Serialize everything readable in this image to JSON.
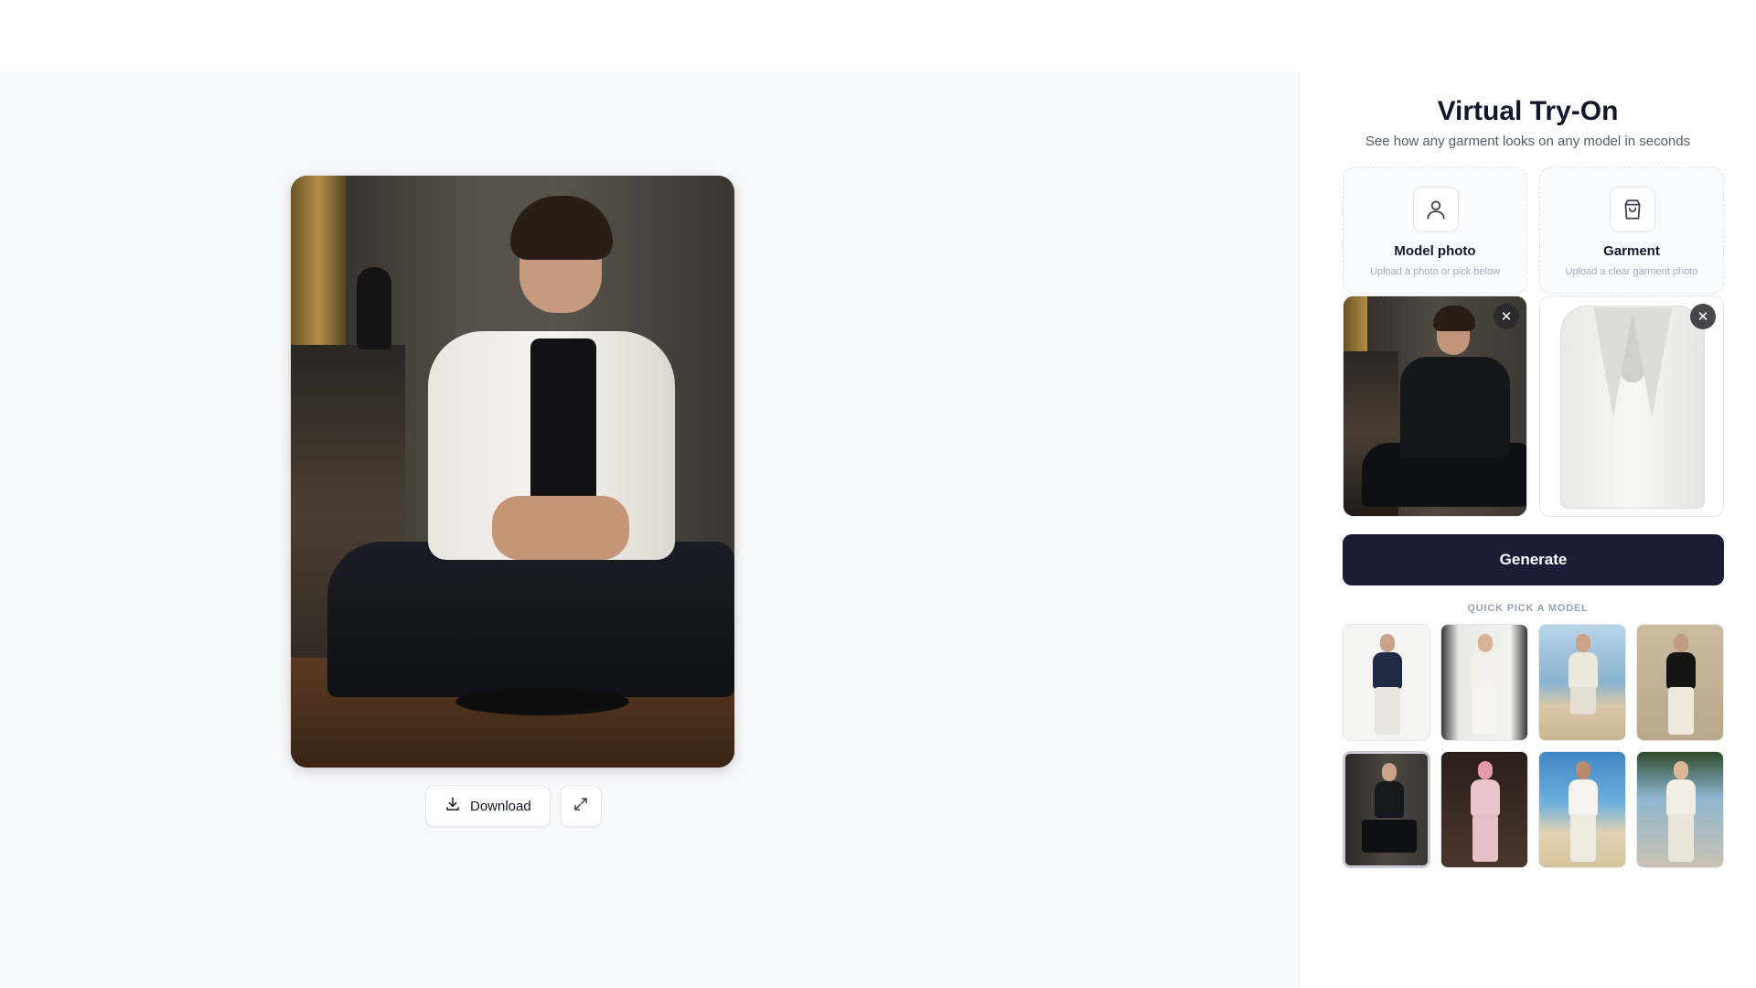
{
  "result": {
    "download_label": "Download"
  },
  "panel": {
    "title": "Virtual Try-On",
    "subtitle": "See how any garment looks on any model in seconds",
    "model_card": {
      "label": "Model photo",
      "hint": "Upload a photo or pick below",
      "icon": "user-icon"
    },
    "garment_card": {
      "label": "Garment",
      "hint": "Upload a clear garment photo",
      "icon": "shopping-bag-icon"
    },
    "remove_symbol": "✕",
    "generate_label": "Generate",
    "quick_pick_label": "QUICK PICK A MODEL",
    "selected_model_index": 4
  },
  "colors": {
    "accent": "#1c1e35",
    "canvas_bg": "#f8f9fb"
  }
}
